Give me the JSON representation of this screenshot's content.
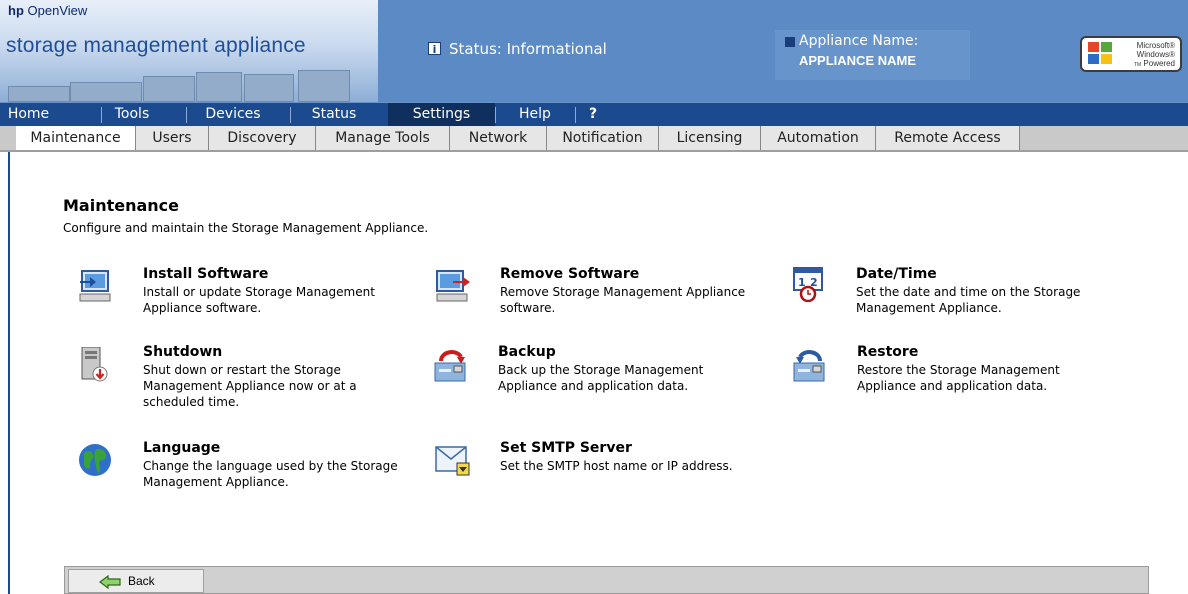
{
  "brand": {
    "hp": "hp",
    "product_line": "OpenView",
    "title": "storage management appliance"
  },
  "status": {
    "text": "Status: Informational",
    "icon": "info-icon"
  },
  "appliance": {
    "label": "Appliance Name:",
    "value": "APPLIANCE NAME"
  },
  "windows_badge": {
    "line1": "Microsoft®",
    "line2": "Windows®",
    "line3": "Powered",
    "tm": "TM"
  },
  "nav": {
    "items": [
      {
        "label": "Home"
      },
      {
        "label": "Tools"
      },
      {
        "label": "Devices"
      },
      {
        "label": "Status"
      },
      {
        "label": "Settings"
      },
      {
        "label": "Help"
      },
      {
        "label": "?"
      }
    ],
    "active": "Settings"
  },
  "subnav": {
    "tabs": [
      {
        "label": "Maintenance"
      },
      {
        "label": "Users"
      },
      {
        "label": "Discovery"
      },
      {
        "label": "Manage Tools"
      },
      {
        "label": "Network"
      },
      {
        "label": "Notification"
      },
      {
        "label": "Licensing"
      },
      {
        "label": "Automation"
      },
      {
        "label": "Remote Access"
      }
    ],
    "active": "Maintenance"
  },
  "page": {
    "title": "Maintenance",
    "subtitle": "Configure and maintain the Storage Management Appliance."
  },
  "tasks": [
    {
      "title": "Install Software",
      "desc": "Install or update Storage Management Appliance software.",
      "icon": "install-software-icon"
    },
    {
      "title": "Remove Software",
      "desc": "Remove Storage Management Appliance software.",
      "icon": "remove-software-icon"
    },
    {
      "title": "Date/Time",
      "desc": "Set the date and time on the Storage Management Appliance.",
      "icon": "calendar-clock-icon"
    },
    {
      "title": "Shutdown",
      "desc": "Shut down or restart the Storage Management Appliance now or at a scheduled time.",
      "icon": "shutdown-icon"
    },
    {
      "title": "Backup",
      "desc": "Back up the Storage Management Appliance and application data.",
      "icon": "backup-icon"
    },
    {
      "title": "Restore",
      "desc": "Restore the Storage Management Appliance and application data.",
      "icon": "restore-icon"
    },
    {
      "title": "Language",
      "desc": "Change the language used by the Storage Management Appliance.",
      "icon": "globe-icon"
    },
    {
      "title": "Set SMTP Server",
      "desc": "Set the SMTP host name or IP address.",
      "icon": "smtp-envelope-icon"
    }
  ],
  "footer": {
    "back_label": "Back",
    "back_icon": "back-arrow-icon"
  },
  "colors": {
    "banner": "#5b8ac4",
    "nav": "#1b4b8e",
    "nav_active": "#0f2f5f",
    "subnav": "#c9c9c9"
  }
}
